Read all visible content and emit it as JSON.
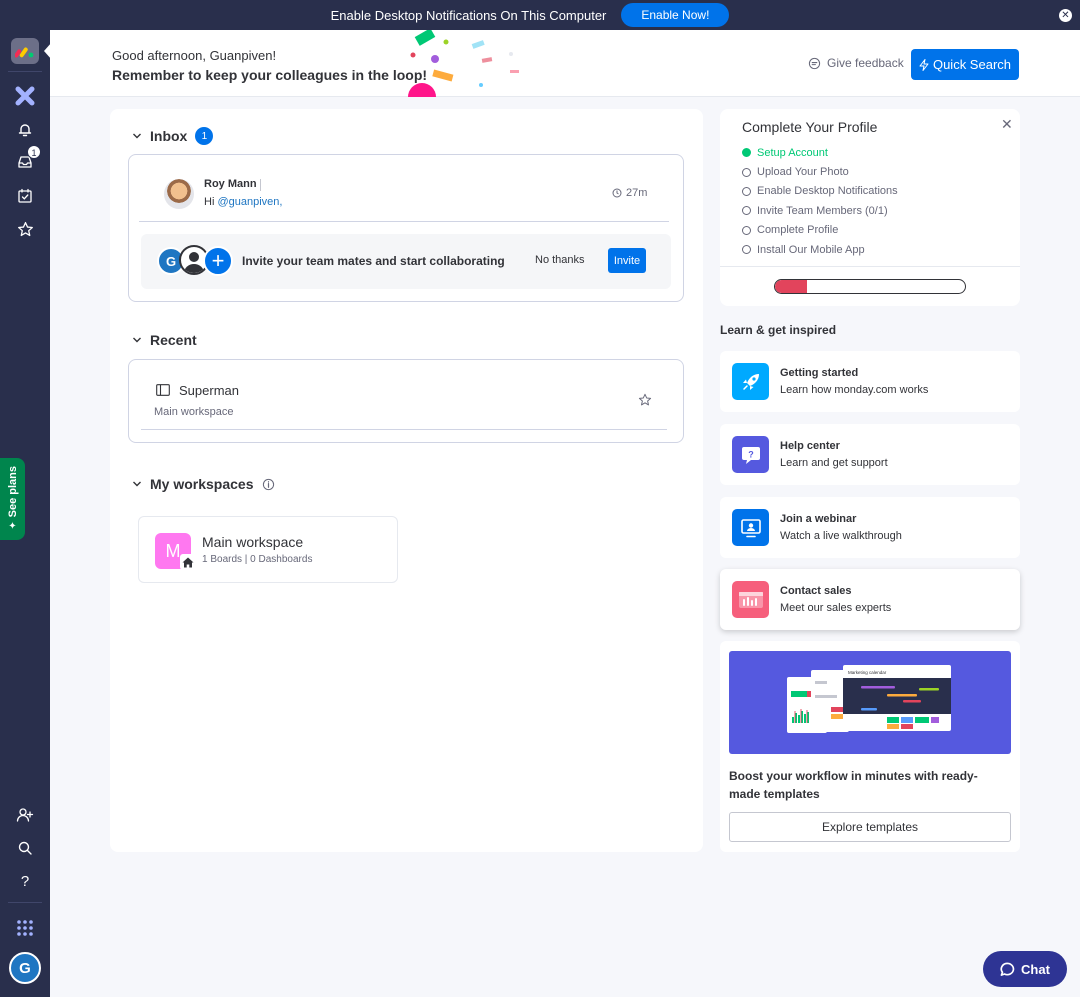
{
  "notification_bar": {
    "text": "Enable Desktop Notifications On This Computer",
    "button": "Enable Now!"
  },
  "sidebar": {
    "inbox_badge": "1",
    "see_plans": "See plans",
    "avatar_initial": "G",
    "items": [
      "logo-icon",
      "workspaces-icon",
      "bell-icon",
      "inbox-icon",
      "my-work-icon",
      "favorites-icon",
      "invite-icon",
      "search-icon",
      "help-icon",
      "apps-icon"
    ]
  },
  "header": {
    "greeting": "Good afternoon, Guanpiven!",
    "subtitle": "Remember to keep your colleagues in the loop!",
    "feedback": "Give feedback",
    "quick_search": "Quick Search"
  },
  "inbox": {
    "title": "Inbox",
    "count": "1",
    "message": {
      "sender": "Roy Mann",
      "greeting": "Hi ",
      "mention": "@guanpiven,",
      "time": "27m"
    },
    "invite_row": {
      "avatar_initial": "G",
      "text": "Invite your team mates and start collaborating",
      "no_thanks": "No thanks",
      "invite": "Invite"
    }
  },
  "recent": {
    "title": "Recent",
    "items": [
      {
        "name": "Superman",
        "workspace": "Main workspace"
      }
    ]
  },
  "workspaces": {
    "title": "My workspaces",
    "items": [
      {
        "initial": "M",
        "name": "Main workspace",
        "meta": "1 Boards | 0 Dashboards"
      }
    ]
  },
  "profile": {
    "title": "Complete Your Profile",
    "steps": [
      {
        "label": "Setup Account",
        "done": true
      },
      {
        "label": "Upload Your Photo",
        "done": false
      },
      {
        "label": "Enable Desktop Notifications",
        "done": false
      },
      {
        "label": "Invite Team Members (0/1)",
        "done": false
      },
      {
        "label": "Complete Profile",
        "done": false
      },
      {
        "label": "Install Our Mobile App",
        "done": false
      }
    ],
    "progress_fraction": 0.17
  },
  "learn": {
    "title": "Learn & get inspired",
    "cards": [
      {
        "title": "Getting started",
        "subtitle": "Learn how monday.com works",
        "icon": "rocket-icon",
        "color": "#00a9ff"
      },
      {
        "title": "Help center",
        "subtitle": "Learn and get support",
        "icon": "help-chat-icon",
        "color": "#5559df"
      },
      {
        "title": "Join a webinar",
        "subtitle": "Watch a live walkthrough",
        "icon": "webinar-icon",
        "color": "#0073ea"
      },
      {
        "title": "Contact sales",
        "subtitle": "Meet our sales experts",
        "icon": "sales-chart-icon",
        "color": "#f65f7c"
      }
    ]
  },
  "templates": {
    "preview_label": "Marketing calendar",
    "text": "Boost your workflow in minutes with ready-made templates",
    "button": "Explore templates"
  },
  "chat": {
    "label": "Chat"
  },
  "colors": {
    "sidebar": "#292f4c",
    "primary": "#0073ea",
    "success": "#00c875",
    "see_plans": "#00854d",
    "chat": "#2e3494"
  }
}
